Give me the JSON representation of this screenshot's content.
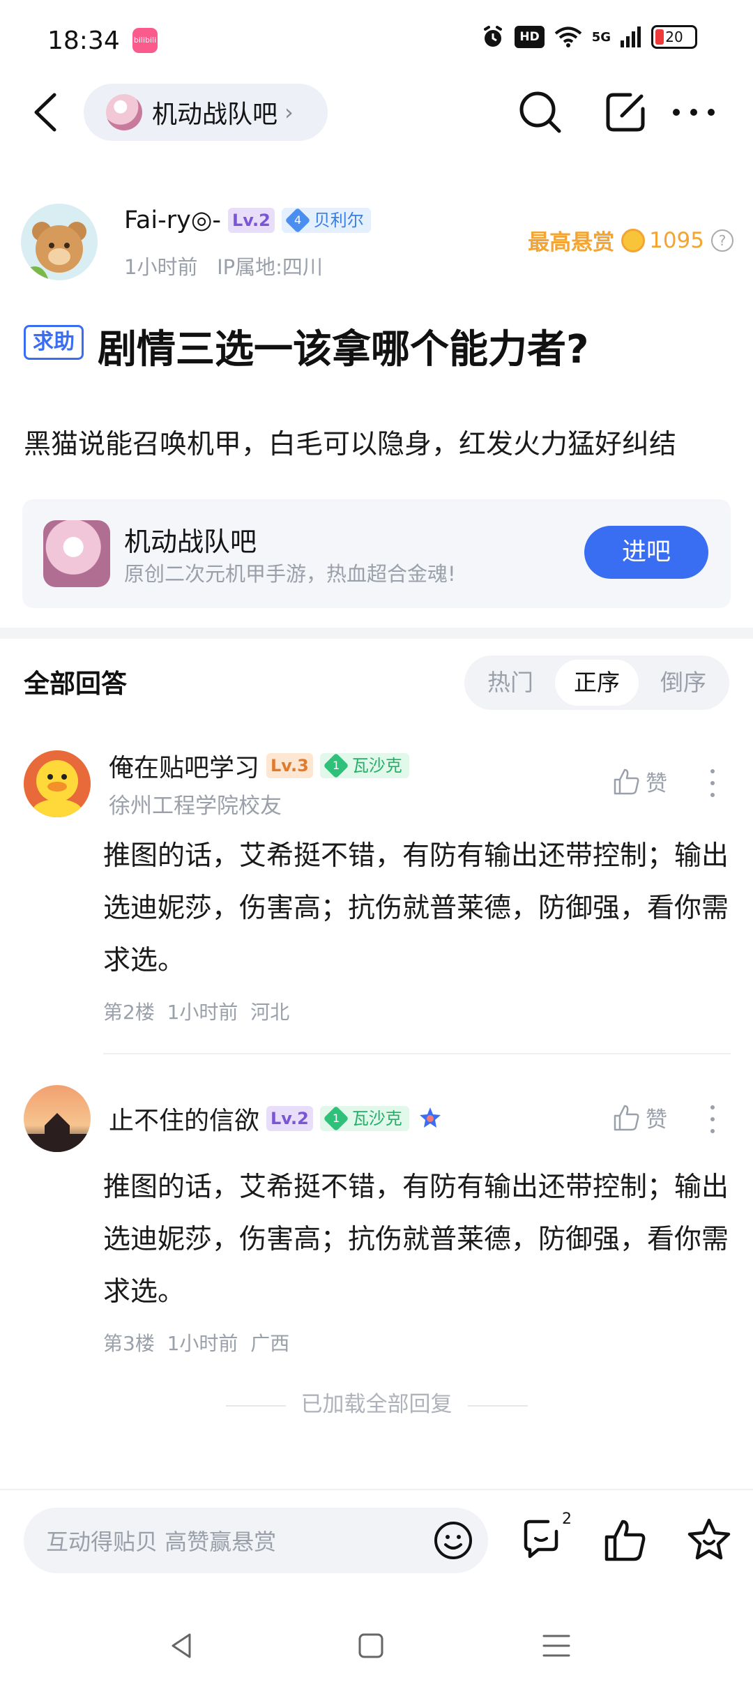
{
  "status_bar": {
    "time": "18:34",
    "app_badge": "bilibili",
    "hd": "HD",
    "network": "5G",
    "battery": "20"
  },
  "nav": {
    "forum_name": "机动战队吧"
  },
  "post": {
    "author": {
      "name": "Fai-ry◎-",
      "level": "Lv.2",
      "rank_num": "4",
      "rank_name": "贝利尔",
      "meta": "1小时前   IP属地:四川"
    },
    "bounty": {
      "label": "最高悬赏",
      "amount": "1095",
      "help": "?"
    },
    "tag": "求助",
    "title": "剧情三选一该拿哪个能力者?",
    "body": "黑猫说能召唤机甲，白毛可以隐身，红发火力猛好纠结"
  },
  "forum_card": {
    "name": "机动战队吧",
    "desc": "原创二次元机甲手游，热血超合金魂!",
    "enter_label": "进吧"
  },
  "answers": {
    "heading": "全部回答",
    "sort_options": [
      "热门",
      "正序",
      "倒序"
    ],
    "active_sort": "正序",
    "items": [
      {
        "name": "俺在贴吧学习",
        "level": "Lv.3",
        "rank_num": "1",
        "rank_name": "瓦沙克",
        "sub": "徐州工程学院校友",
        "like": "赞",
        "body": "推图的话，艾希挺不错，有防有输出还带控制；输出选迪妮莎，伤害高；抗伤就普莱德，防御强，看你需求选。",
        "meta": "第2楼  1小时前  河北"
      },
      {
        "name": "止不住的信欲",
        "level": "Lv.2",
        "rank_num": "1",
        "rank_name": "瓦沙克",
        "sub": "",
        "like": "赞",
        "body": "推图的话，艾希挺不错，有防有输出还带控制；输出选迪妮莎，伤害高；抗伤就普莱德，防御强，看你需求选。",
        "meta": "第3楼  1小时前  广西"
      }
    ],
    "loaded_all": "已加载全部回复"
  },
  "bottom_bar": {
    "input_placeholder": "互动得贴贝 高赞赢悬赏",
    "comment_count": "2"
  },
  "colors": {
    "accent": "#3a6ef2",
    "bounty": "#f3a432",
    "muted": "#9aa0aa"
  }
}
